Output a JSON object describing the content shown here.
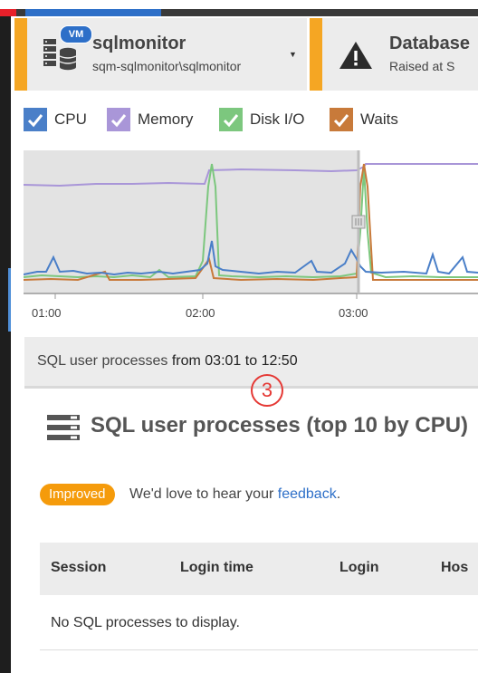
{
  "server_card": {
    "badge": "VM",
    "name": "sqlmonitor",
    "path": "sqm-sqlmonitor\\sqlmonitor",
    "icon": "server-database-icon",
    "accent": "#f5a623"
  },
  "alert_card": {
    "title": "Database",
    "subtitle": "Raised at S",
    "icon": "warning-triangle-icon"
  },
  "legend": [
    {
      "label": "CPU",
      "color": "#4a7fc8",
      "checked": true
    },
    {
      "label": "Memory",
      "color": "#a996d8",
      "checked": true
    },
    {
      "label": "Disk I/O",
      "color": "#7cc77e",
      "checked": true
    },
    {
      "label": "Waits",
      "color": "#c87a3a",
      "checked": true
    }
  ],
  "chart_data": {
    "type": "line",
    "x_ticks": [
      "01:00",
      "02:00",
      "03:00"
    ],
    "selection": "03:00",
    "series": [
      {
        "name": "CPU",
        "color": "#4a7fc8"
      },
      {
        "name": "Memory",
        "color": "#a996d8"
      },
      {
        "name": "Disk I/O",
        "color": "#7cc77e"
      },
      {
        "name": "Waits",
        "color": "#c87a3a"
      }
    ]
  },
  "range": {
    "prefix": "SQL user processes",
    "from_label": "from",
    "from": "03:01",
    "to_label": "to",
    "to": "12:50",
    "marker": "3"
  },
  "section": {
    "title": "SQL user processes (top 10 by CPU)",
    "icon": "list-icon"
  },
  "feedback": {
    "badge": "Improved",
    "text": "We'd love to hear your",
    "link": "feedback",
    "period": "."
  },
  "table": {
    "columns": [
      "Session",
      "Login time",
      "Login",
      "Hos"
    ],
    "empty_message": "No SQL processes to display."
  }
}
